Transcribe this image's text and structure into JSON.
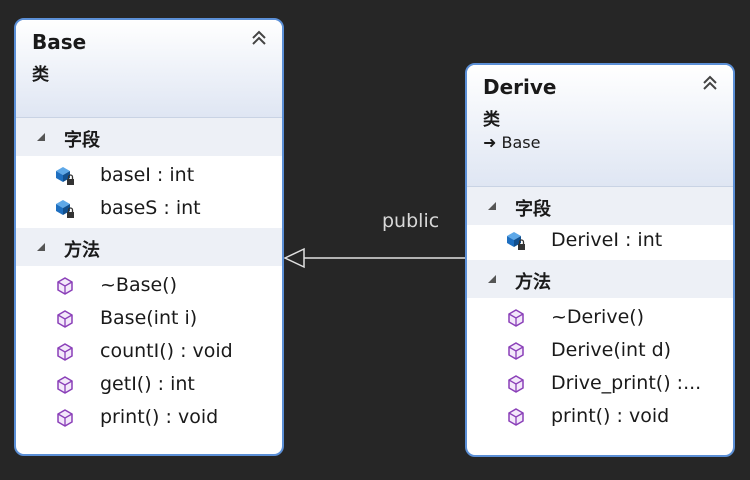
{
  "classes": {
    "base": {
      "name": "Base",
      "kind": "类",
      "sections": {
        "fields": {
          "label": "字段",
          "items": [
            "baseI : int",
            "baseS : int"
          ]
        },
        "methods": {
          "label": "方法",
          "items": [
            "~Base()",
            "Base(int i)",
            "countI() : void",
            "getI() : int",
            "print() : void"
          ]
        }
      }
    },
    "derive": {
      "name": "Derive",
      "kind": "类",
      "inherits": "Base",
      "sections": {
        "fields": {
          "label": "字段",
          "items": [
            "DeriveI : int"
          ]
        },
        "methods": {
          "label": "方法",
          "items": [
            "~Derive()",
            "Derive(int d)",
            "Drive_print() :...",
            "print() : void"
          ]
        }
      }
    }
  },
  "relationship": {
    "label": "public",
    "type": "inheritance",
    "from": "Derive",
    "to": "Base"
  },
  "icons": {
    "collapse": "double-chevron-up-icon",
    "section_toggle": "expanded-triangle-icon",
    "field": "field-lock-icon",
    "method": "method-cube-icon",
    "inherits": "inherits-arrow-icon"
  },
  "colors": {
    "background": "#262626",
    "box_border": "#5b8fd6",
    "header_gradient_end": "#dfe6f3",
    "section_bg": "#edf0f6",
    "field_icon": "#1e6fc0",
    "method_icon": "#8a3fb8",
    "connector": "#e0e0e0"
  }
}
